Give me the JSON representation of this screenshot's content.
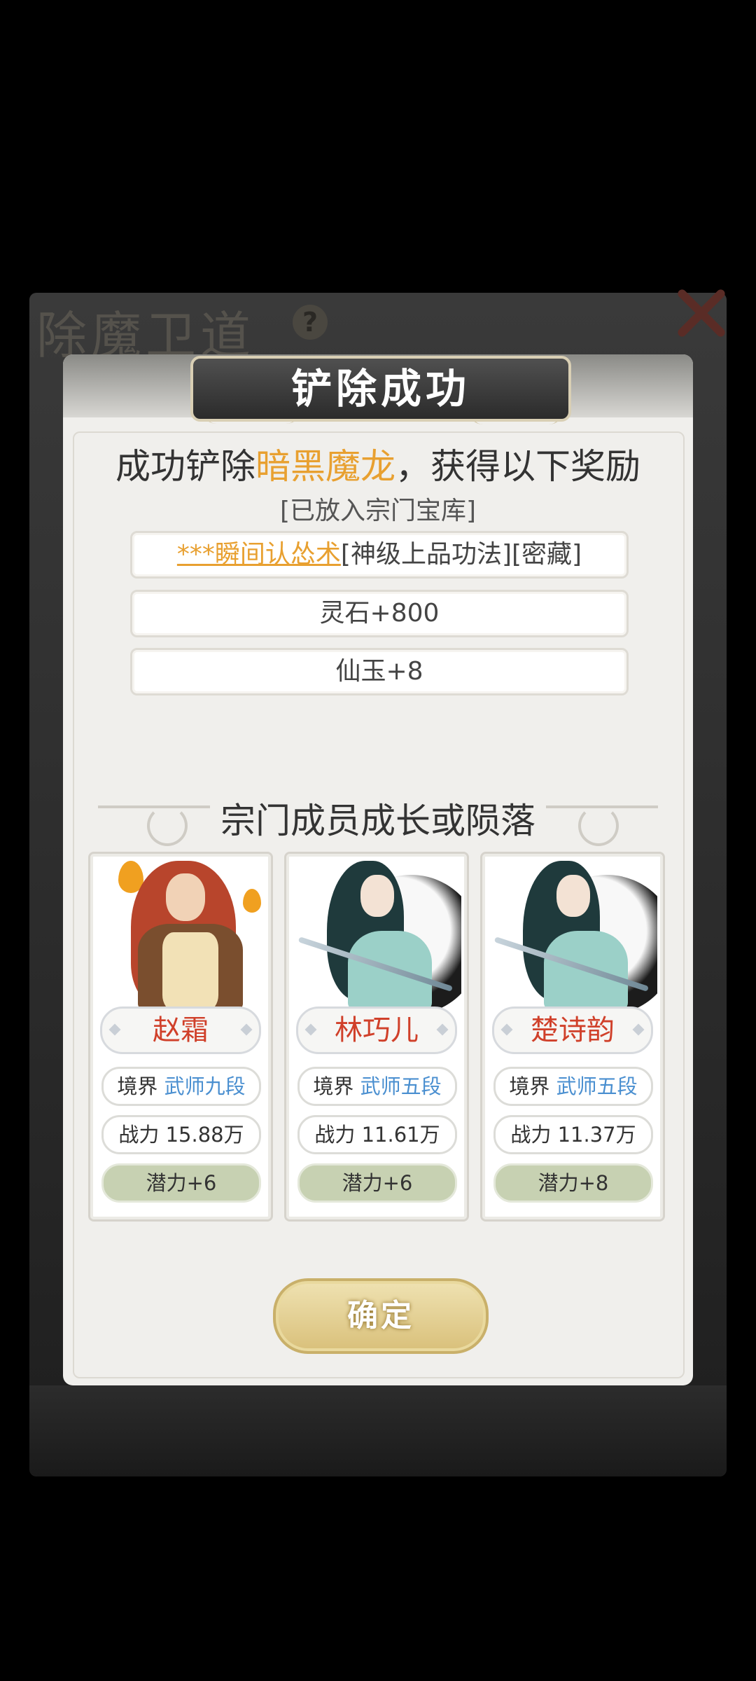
{
  "background_dialog": {
    "title": "除魔卫道",
    "help_icon": "?"
  },
  "dialog": {
    "title": "铲除成功",
    "headline_prefix": "成功铲除",
    "headline_target": "暗黑魔龙",
    "headline_suffix": "，获得以下奖励",
    "note": "[已放入宗门宝库]",
    "rewards": [
      {
        "highlight": "***瞬间认怂术",
        "text": "[神级上品功法][密藏]"
      },
      {
        "text": "灵石+800"
      },
      {
        "text": "仙玉+8"
      }
    ],
    "section_title": "宗门成员成长或陨落",
    "members": [
      {
        "name": "赵霜",
        "realm_label": "境界",
        "realm": "武师九段",
        "power": "战力 15.88万",
        "potential": "潜力+6"
      },
      {
        "name": "林巧儿",
        "realm_label": "境界",
        "realm": "武师五段",
        "power": "战力 11.61万",
        "potential": "潜力+6"
      },
      {
        "name": "楚诗韵",
        "realm_label": "境界",
        "realm": "武师五段",
        "power": "战力 11.37万",
        "potential": "潜力+8"
      }
    ],
    "confirm_label": "确定"
  },
  "colors": {
    "highlight_gold": "#e8a030",
    "name_red": "#d0402a",
    "realm_blue": "#4a8fd0",
    "potential_green": "#c7d1b2"
  }
}
